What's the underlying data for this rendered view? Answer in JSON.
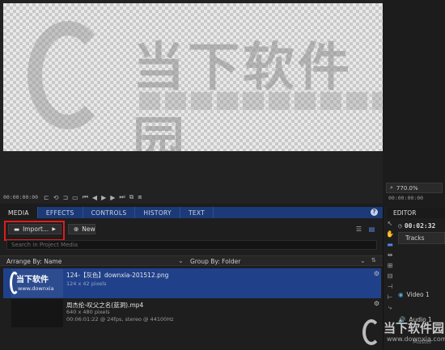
{
  "viewer": {
    "timecode_left": "00:00:00:00",
    "zoom_level": "770.0%",
    "timecode_right": "00:00:00:00",
    "watermark_text": "当下软件园"
  },
  "media_panel": {
    "tabs": [
      {
        "label": "MEDIA",
        "active": true
      },
      {
        "label": "EFFECTS",
        "active": false
      },
      {
        "label": "CONTROLS",
        "active": false
      },
      {
        "label": "HISTORY",
        "active": false
      },
      {
        "label": "TEXT",
        "active": false
      }
    ],
    "help_icon": "?",
    "import_label": "Import...",
    "new_label": "New",
    "search_placeholder": "Search in Project Media",
    "arrange_label": "Arrange By: Name",
    "group_label": "Group By: Folder",
    "items": [
      {
        "thumb_title": "当下软件",
        "thumb_sub": "www.downxia",
        "name": "124-【灰色】downxia-201512.png",
        "meta1": "124 x 42 pixels",
        "meta2": "",
        "selected": true
      },
      {
        "thumb_title": "",
        "thumb_sub": "",
        "name": "周杰伦-叹父之名(蓝洞).mp4",
        "meta1": "640 x 480 pixels",
        "meta2": "00:06:01:22 @ 24fps, stereo @ 44100Hz",
        "selected": false
      }
    ]
  },
  "editor": {
    "tab_label": "EDITOR",
    "timecode": "00:02:32",
    "tracks_label": "Tracks",
    "video_track": "Video 1",
    "audio_track": "Audio 1",
    "master_label": "Master"
  },
  "corner_watermark": {
    "title": "当下软件园",
    "subtitle": "www.downxia.com"
  }
}
